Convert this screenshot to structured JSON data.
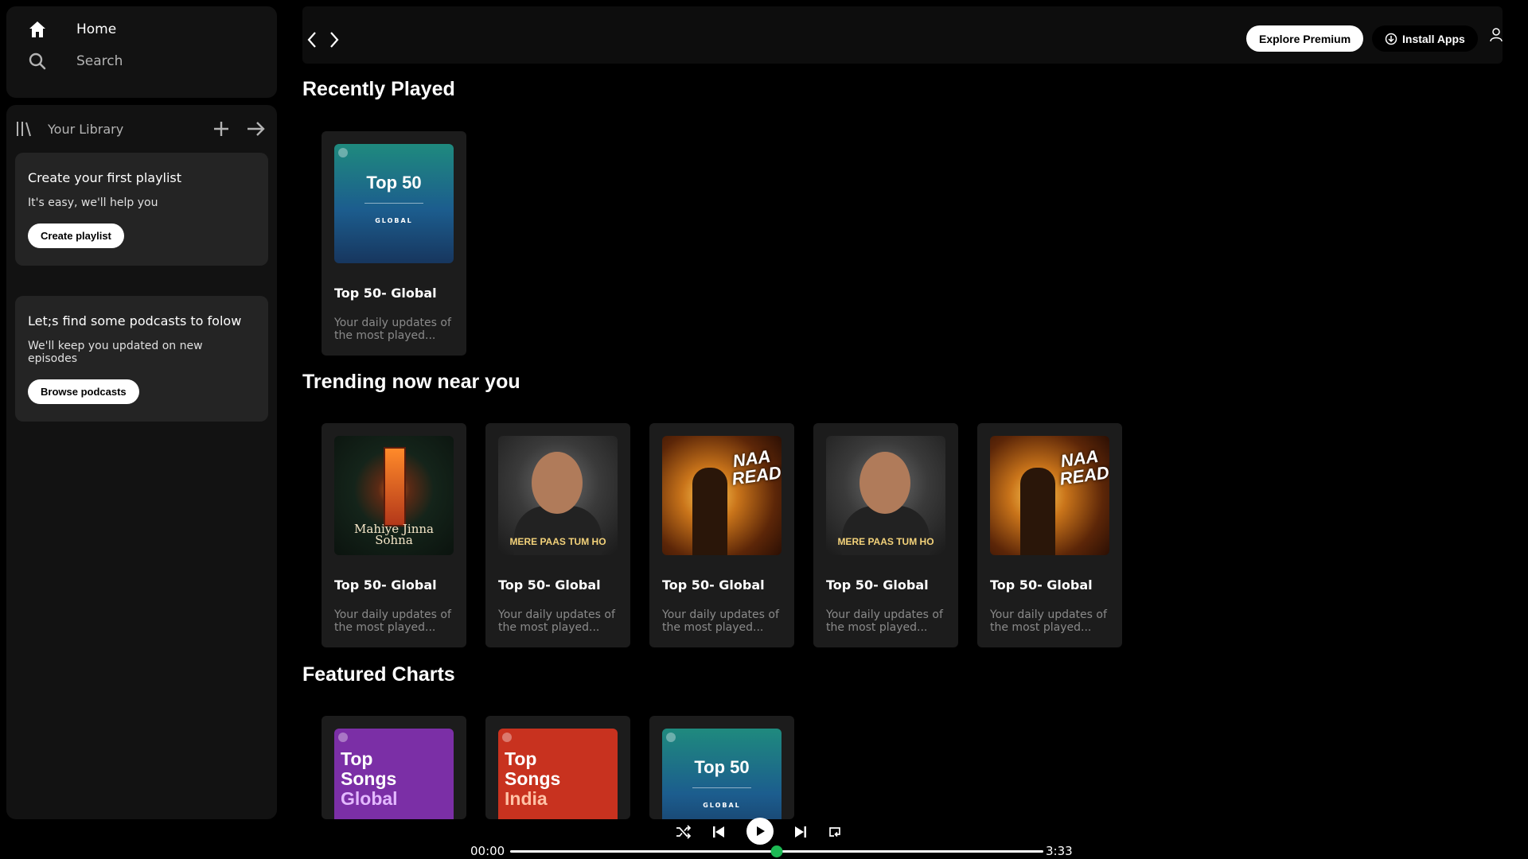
{
  "sidebar": {
    "nav": [
      {
        "label": "Home",
        "icon": "home-icon"
      },
      {
        "label": "Search",
        "icon": "search-icon"
      }
    ],
    "library": {
      "label": "Your Library"
    },
    "cards": [
      {
        "title": "Create your first playlist",
        "text": "It's easy, we'll help you",
        "button": "Create playlist"
      },
      {
        "title": "Let;s find some podcasts to folow",
        "text": "We'll keep you updated on new episodes",
        "button": "Browse podcasts"
      }
    ]
  },
  "topbar": {
    "explore_label": "Explore Premium",
    "install_label": "Install Apps"
  },
  "sections": {
    "recent": {
      "title": "Recently Played",
      "cards": [
        {
          "title": "Top 50- Global",
          "desc": "Your daily updates of the most played...",
          "art": {
            "big": "Top 50",
            "small": "GLOBAL"
          }
        }
      ]
    },
    "trending": {
      "title": "Trending now near you",
      "cards": [
        {
          "title": "Top 50- Global",
          "desc": "Your daily updates of the most played...",
          "art_text": "Mahiye Jinna Sohna"
        },
        {
          "title": "Top 50- Global",
          "desc": "Your daily updates of the most played...",
          "art_text": "MERE PAAS TUM HO"
        },
        {
          "title": "Top 50- Global",
          "desc": "Your daily updates of the most played...",
          "art_text": "NAA READY"
        },
        {
          "title": "Top 50- Global",
          "desc": "Your daily updates of the most played...",
          "art_text": "MERE PAAS TUM HO"
        },
        {
          "title": "Top 50- Global",
          "desc": "Your daily updates of the most played...",
          "art_text": "NAA READY"
        }
      ]
    },
    "featured": {
      "title": "Featured Charts",
      "cards": [
        {
          "line1": "Top",
          "line2": "Songs",
          "line3": "Global"
        },
        {
          "line1": "Top",
          "line2": "Songs",
          "line3": "India"
        },
        {
          "big": "Top 50",
          "small": "GLOBAL"
        }
      ]
    }
  },
  "player": {
    "current_time": "00:00",
    "duration": "3:33",
    "progress": 0.5
  },
  "colors": {
    "accent": "#1db954",
    "card_bg": "#1c1c1c",
    "panel_bg": "#121212"
  }
}
